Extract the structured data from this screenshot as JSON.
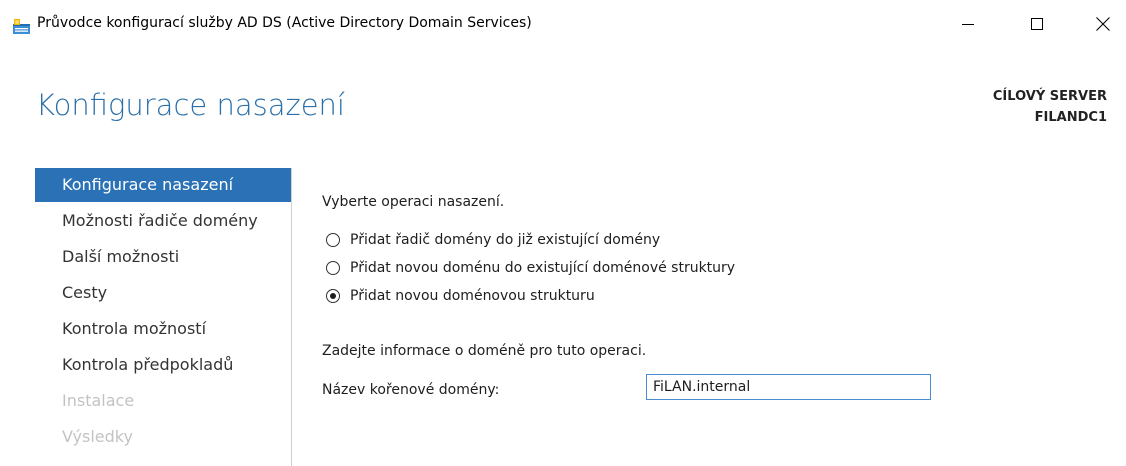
{
  "window": {
    "title": "Průvodce konfigurací služby AD DS (Active Directory Domain Services)",
    "icon": "server-wizard-icon",
    "controls": {
      "minimize_icon": "minimize-icon",
      "maximize_icon": "maximize-icon",
      "close_icon": "close-icon"
    }
  },
  "header": {
    "page_title": "Konfigurace nasazení",
    "target_server_label": "CÍLOVÝ SERVER",
    "target_server_name": "FILANDC1"
  },
  "nav": {
    "items": [
      {
        "label": "Konfigurace nasazení",
        "state": "active"
      },
      {
        "label": "Možnosti řadiče domény",
        "state": "enabled"
      },
      {
        "label": "Další možnosti",
        "state": "enabled"
      },
      {
        "label": "Cesty",
        "state": "enabled"
      },
      {
        "label": "Kontrola možností",
        "state": "enabled"
      },
      {
        "label": "Kontrola předpokladů",
        "state": "enabled"
      },
      {
        "label": "Instalace",
        "state": "disabled"
      },
      {
        "label": "Výsledky",
        "state": "disabled"
      }
    ]
  },
  "main": {
    "prompt": "Vyberte operaci nasazení.",
    "options": [
      {
        "label": "Přidat řadič domény do již existující domény",
        "selected": false
      },
      {
        "label": "Přidat novou doménu do existující doménové struktury",
        "selected": false
      },
      {
        "label": "Přidat novou doménovou strukturu",
        "selected": true
      }
    ],
    "info_text": "Zadejte informace o doméně pro tuto operaci.",
    "root_domain_label": "Název kořenové domény:",
    "root_domain_value": "FiLAN.internal"
  },
  "colors": {
    "accent": "#2a71b6",
    "title_blue": "#2b6fa8",
    "disabled_text": "#c3c3c3",
    "input_border": "#4a8cd0"
  }
}
